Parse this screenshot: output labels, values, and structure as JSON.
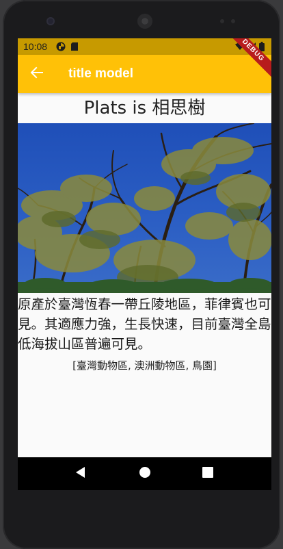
{
  "status_bar": {
    "time": "10:08",
    "icons": [
      "app-notification-icon",
      "sd-card-icon",
      "wifi-icon",
      "signal-icon",
      "battery-icon"
    ]
  },
  "app_bar": {
    "title": "title model",
    "back_icon": "arrow-back-icon",
    "debug_banner": "DEBUG",
    "color": "#ffc107"
  },
  "content": {
    "heading": "Plats is 相思樹",
    "image_alt": "相思樹",
    "description": "原產於臺灣恆春一帶丘陵地區，菲律賓也可見。其適應力強，生長快速，目前臺灣全島低海拔山區普遍可見。",
    "locations": "[臺灣動物區, 澳洲動物區, 鳥園]"
  },
  "nav_bar": {
    "buttons": [
      "back-triangle-icon",
      "home-circle-icon",
      "overview-square-icon"
    ]
  }
}
